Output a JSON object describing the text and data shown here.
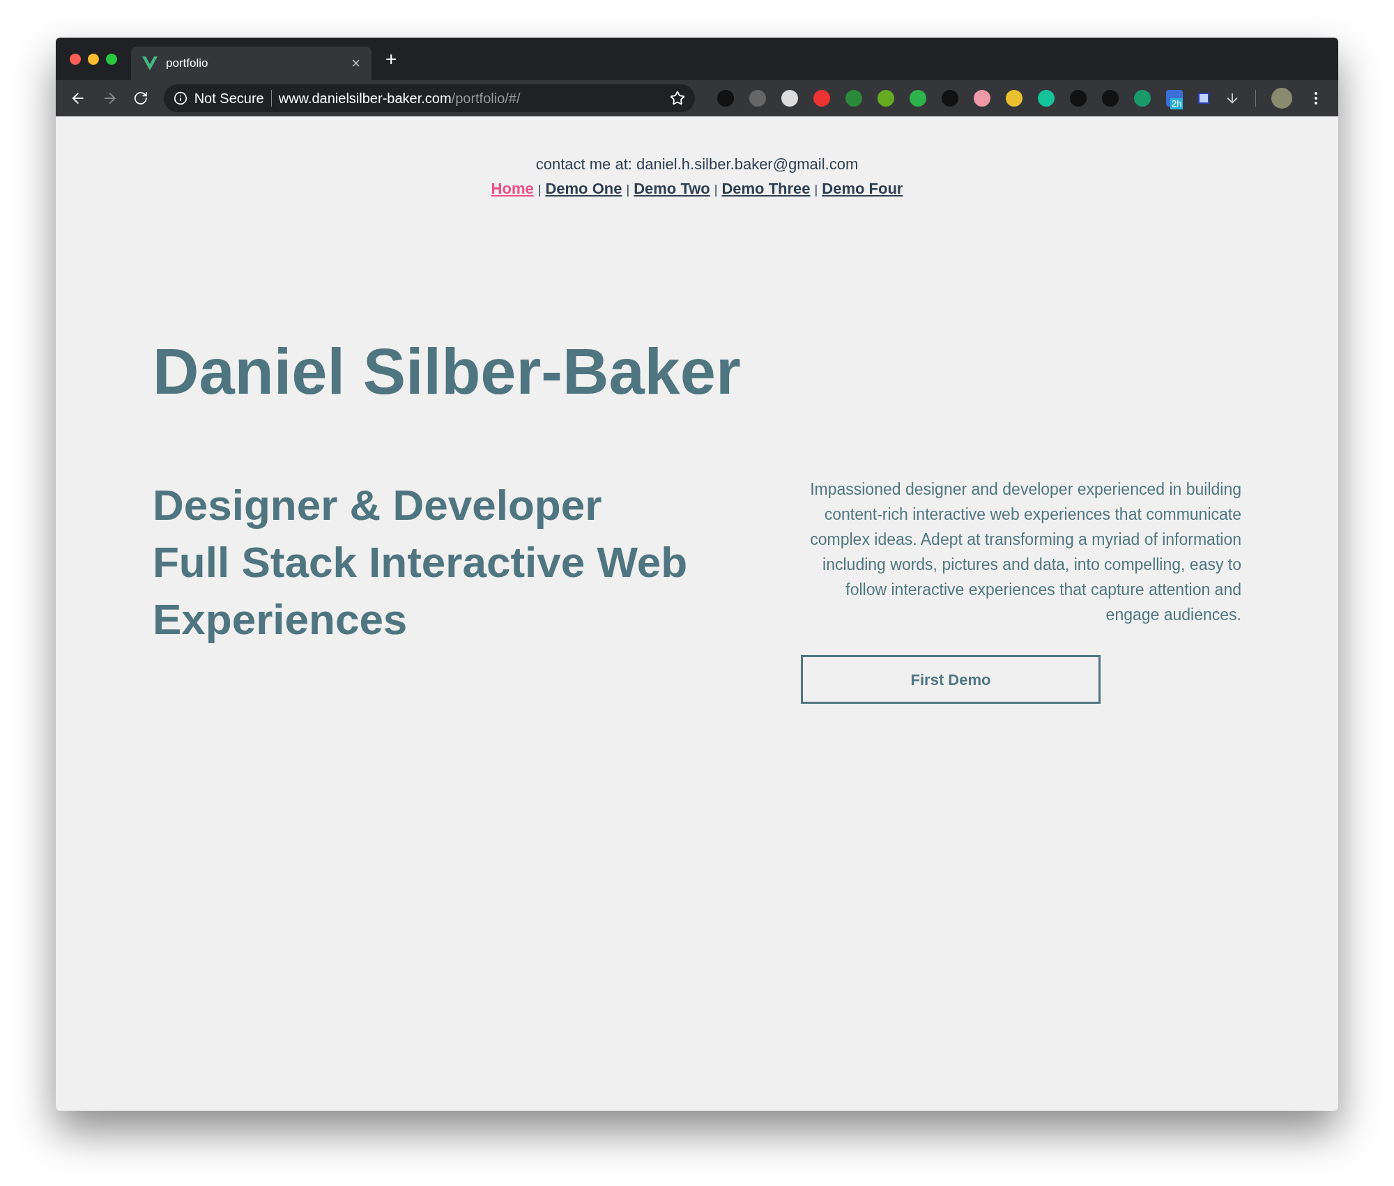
{
  "browser": {
    "tab": {
      "title": "portfolio",
      "close": "×"
    },
    "new_tab": "+",
    "security": "Not Secure",
    "url_host": "www.danielsilber-baker.com",
    "url_path": "/portfolio/#/",
    "extension_badge": "2h"
  },
  "header": {
    "contact": "contact me at: daniel.h.silber.baker@gmail.com",
    "nav": [
      {
        "kind": "link",
        "text": "Home",
        "selected": true
      },
      {
        "kind": "separator",
        "text": "|"
      },
      {
        "kind": "link",
        "text": "Demo One",
        "selected": false
      },
      {
        "kind": "separator",
        "text": "|"
      },
      {
        "kind": "link",
        "text": "Demo Two",
        "selected": false
      },
      {
        "kind": "separator",
        "text": "|"
      },
      {
        "kind": "link",
        "text": "Demo Three",
        "selected": false
      },
      {
        "kind": "separator",
        "text": "|"
      },
      {
        "kind": "link",
        "text": "Demo Four",
        "selected": false
      }
    ]
  },
  "hero": {
    "name": "Daniel Silber-Baker",
    "roles": [
      "Designer & Developer",
      "Full Stack Interactive Web Experiences"
    ],
    "description": "Impassioned designer and developer experienced in building content-rich interactive web experiences that communicate complex ideas. Adept at transforming a myriad of information including words, pictures and data, into compelling, easy to follow interactive experiences that capture attention and engage audiences.",
    "button": "First Demo"
  }
}
